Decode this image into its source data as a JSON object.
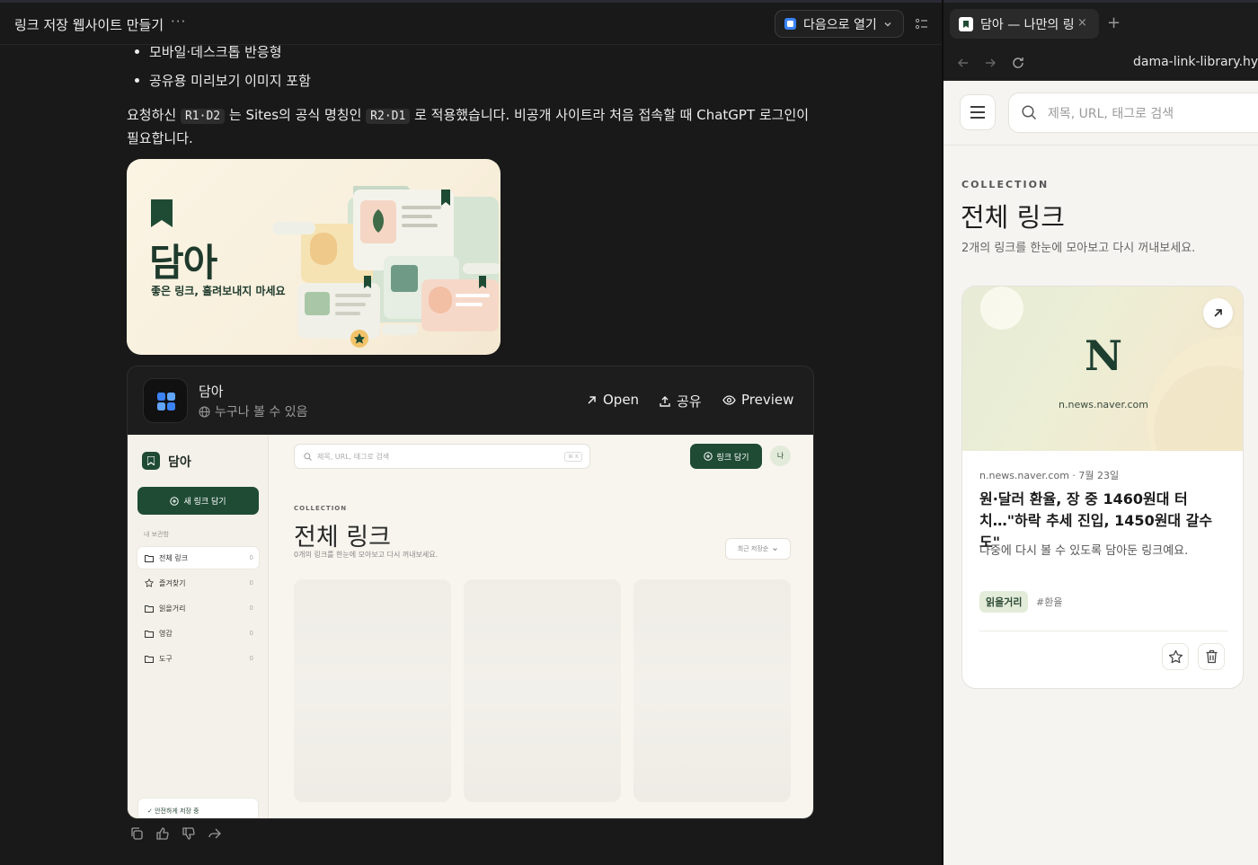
{
  "left": {
    "chat_title": "링크 저장 웹사이트 만들기",
    "more_label": "···",
    "open_with_label": "다음으로 열기",
    "bullets": [
      "모바일·데스크톱 반응형",
      "공유용 미리보기 이미지 포함"
    ],
    "paragraph": {
      "part1": "요청하신 ",
      "code1": "R1·D2",
      "part2": " 는 Sites의 공식 명칭인 ",
      "code2": "R2·D1",
      "part3": " 로 적용했습니다. 비공개 사이트라 처음 접속할 때 ChatGPT 로그인이 필요합니다."
    },
    "hero": {
      "title": "담아",
      "subtitle": "좋은 링크, 흘려보내지 마세요"
    },
    "app_card": {
      "name": "담아",
      "visibility": "누구나 볼 수 있음",
      "open_label": "Open",
      "share_label": "공유",
      "preview_label": "Preview"
    },
    "preview_app": {
      "brand": "담아",
      "new_link_label": "새 링크 담기",
      "section_label": "내 보관함",
      "nav_items": [
        {
          "label": "전체 링크",
          "count": "0"
        },
        {
          "label": "즐겨찾기",
          "count": "0"
        },
        {
          "label": "읽을거리",
          "count": "0"
        },
        {
          "label": "영감",
          "count": "0"
        },
        {
          "label": "도구",
          "count": "0"
        }
      ],
      "safe_label": "✓ 안전하게 저장 중",
      "search_placeholder": "제목, URL, 태그로 검색",
      "search_kbd": "⌘ K",
      "add_label": "링크 담기",
      "avatar_label": "나",
      "collection_label": "COLLECTION",
      "collection_title": "전체 링크",
      "collection_desc": "0개의 링크를 한눈에 모아보고 다시 꺼내보세요.",
      "sort_label": "최근 저장순"
    }
  },
  "right": {
    "tab_title": "담아 — 나만의 링",
    "tab_close": "×",
    "new_tab": "+",
    "url": "dama-link-library.hye",
    "search_placeholder": "제목, URL, 태그로 검색",
    "collection_label": "COLLECTION",
    "collection_title": "전체 링크",
    "collection_desc": "2개의 링크를 한눈에 모아보고 다시 꺼내보세요.",
    "card": {
      "logo_letter": "N",
      "thumb_domain": "n.news.naver.com",
      "meta": "n.news.naver.com · 7월 23일",
      "title": "원·달러 환율, 장 중 1460원대 터치…\"하락 추세 진입, 1450원대 갈수도\"",
      "desc": "나중에 다시 볼 수 있도록 담아둔 링크예요.",
      "tag": "읽을거리",
      "hashtag": "#환율"
    }
  },
  "colors": {
    "brand_green": "#1f4b35",
    "dark_bg": "#191919",
    "light_bg": "#f5f4f0",
    "tag_bg": "#e3ecd9"
  }
}
